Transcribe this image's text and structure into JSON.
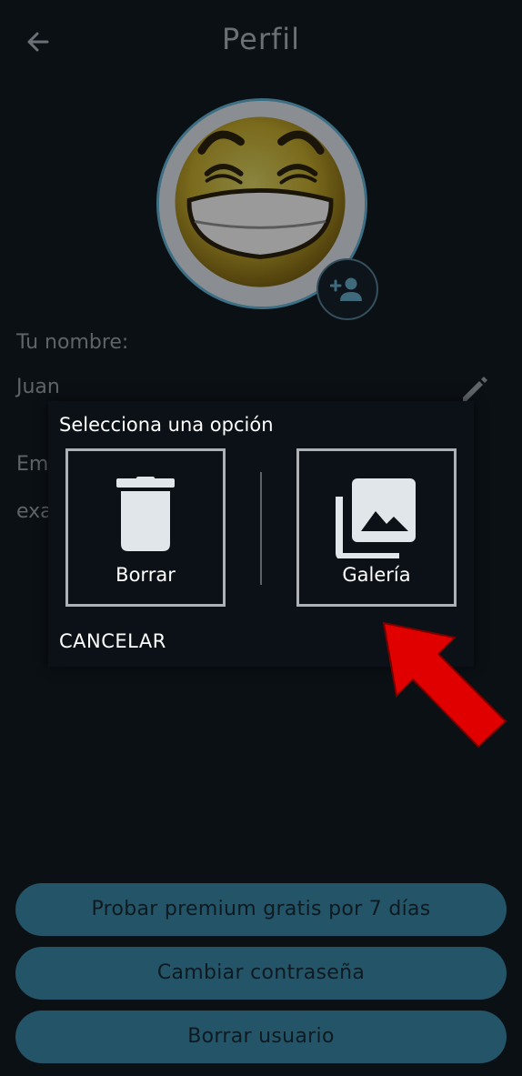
{
  "header": {
    "title": "Perfil",
    "back_icon": "arrow-left-icon"
  },
  "profile": {
    "avatar_icon": "laughing-smiley-avatar",
    "add_photo_icon": "person-add-icon",
    "name_label": "Tu nombre:",
    "name_value": "Juan",
    "edit_icon": "pencil-icon",
    "email_label_partial": "Em",
    "email_value_partial": "exa"
  },
  "dialog": {
    "title": "Selecciona una opción",
    "options": [
      {
        "label": "Borrar",
        "icon": "trash-icon"
      },
      {
        "label": "Galería",
        "icon": "photo-library-icon"
      }
    ],
    "cancel_label": "CANCELAR"
  },
  "annotation": {
    "icon": "red-arrow-icon",
    "color": "#e10000"
  },
  "actions": {
    "premium_label": "Probar premium gratis por 7 días",
    "change_password_label": "Cambiar contraseña",
    "delete_user_label": "Borrar usuario"
  },
  "colors": {
    "background": "#0b1015",
    "button": "#245468",
    "dialog_bg": "#0b1116",
    "dim_text": "#5f6469"
  }
}
